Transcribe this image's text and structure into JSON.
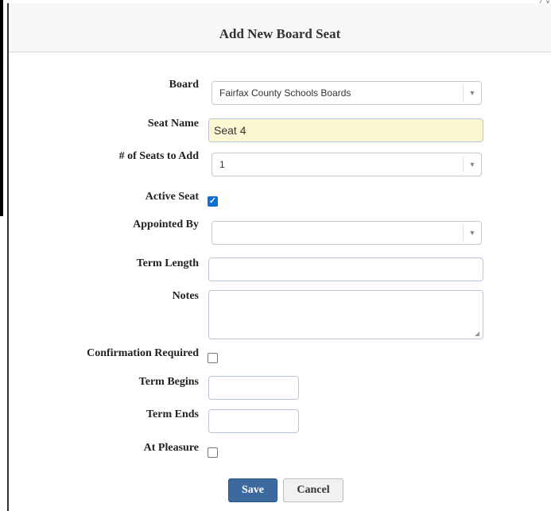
{
  "modal": {
    "title": "Add New Board Seat",
    "close_glyph": "×"
  },
  "form": {
    "board": {
      "label": "Board",
      "value": "Fairfax County Schools Boards"
    },
    "seat_name": {
      "label": "Seat Name",
      "value": "Seat   4"
    },
    "seats_to_add": {
      "label": "# of Seats to Add",
      "value": "1"
    },
    "active_seat": {
      "label": "Active Seat",
      "checked": true,
      "check_glyph": "✓"
    },
    "appointed_by": {
      "label": "Appointed By",
      "value": ""
    },
    "term_length": {
      "label": "Term Length",
      "value": ""
    },
    "notes": {
      "label": "Notes",
      "value": ""
    },
    "confirmation_required": {
      "label": "Confirmation Required",
      "checked": false
    },
    "term_begins": {
      "label": "Term Begins",
      "value": ""
    },
    "term_ends": {
      "label": "Term Ends",
      "value": ""
    },
    "at_pleasure": {
      "label": "At Pleasure",
      "checked": false
    }
  },
  "buttons": {
    "save": "Save",
    "cancel": "Cancel"
  },
  "icons": {
    "dropdown_arrow": "▼",
    "resize_handle": "◢"
  }
}
